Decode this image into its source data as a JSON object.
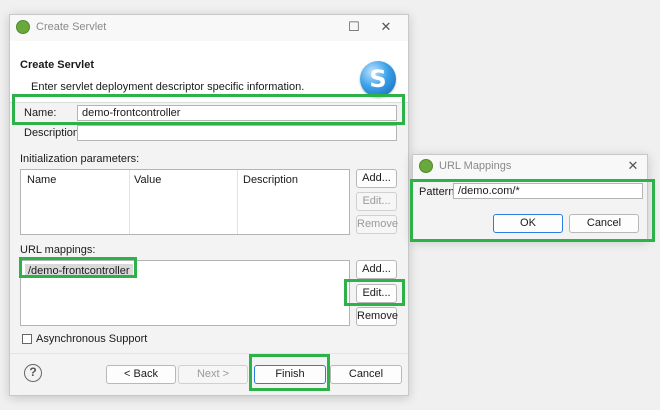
{
  "servlet_dialog": {
    "title": "Create Servlet",
    "header_title": "Create Servlet",
    "header_desc": "Enter servlet deployment descriptor specific information.",
    "logo_letter": "S",
    "name_label": "Name:",
    "name_value": "demo-frontcontroller",
    "description_label": "Description:",
    "description_value": "",
    "init_params_label": "Initialization parameters:",
    "init_columns": [
      "Name",
      "Value",
      "Description"
    ],
    "init_add": "Add...",
    "init_edit": "Edit...",
    "init_remove": "Remove",
    "url_label": "URL mappings:",
    "url_items": [
      "/demo-frontcontroller"
    ],
    "url_add": "Add...",
    "url_edit": "Edit...",
    "url_remove": "Remove",
    "async_label": "Asynchronous Support",
    "async_checked": false,
    "back": "< Back",
    "next": "Next >",
    "finish": "Finish",
    "cancel": "Cancel"
  },
  "url_dialog": {
    "title": "URL Mappings",
    "pattern_label": "Pattern:",
    "pattern_value": "/demo.com/*",
    "ok": "OK",
    "cancel": "Cancel"
  },
  "colors": {
    "highlight": "#2db24a",
    "primary_border": "#2a7de1",
    "eclipse_green": "#6aa83b"
  }
}
